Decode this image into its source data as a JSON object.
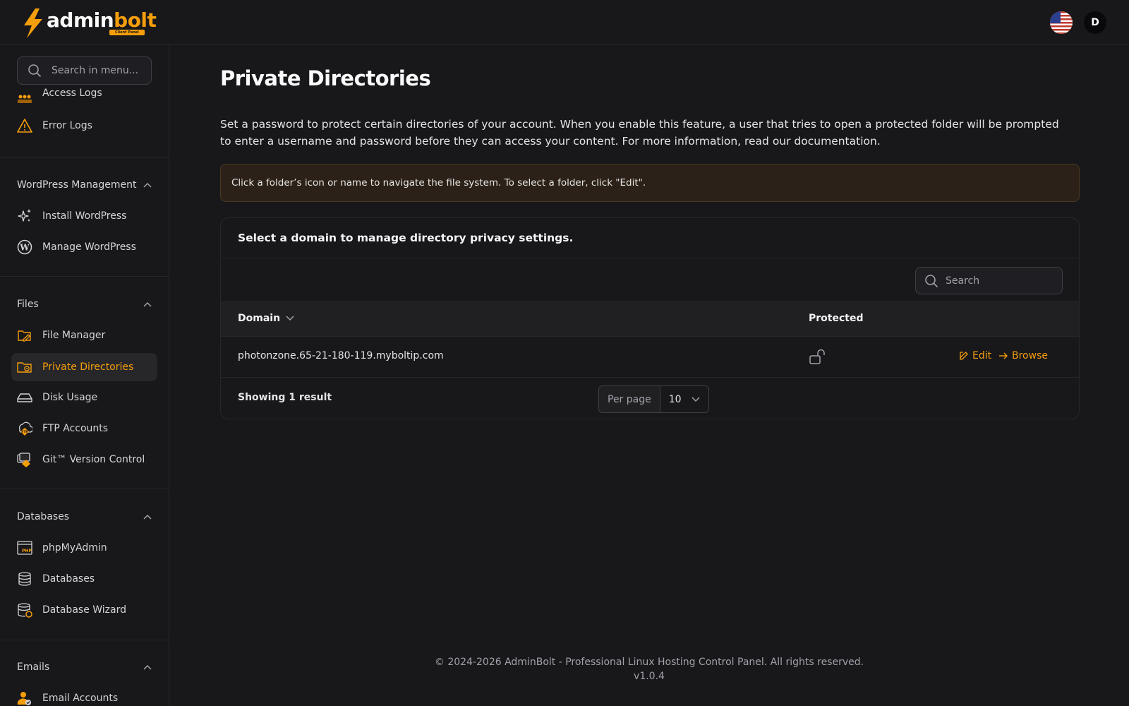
{
  "brand": {
    "name_white": "admin",
    "name_orange": "bolt",
    "badge": "Client Panel"
  },
  "header": {
    "avatar_initial": "D",
    "language_icon": "us-flag-icon"
  },
  "sidebar": {
    "search_placeholder": "Search in menu...",
    "top_items": [
      {
        "label": "Access Logs",
        "icon": "access-logs-icon"
      },
      {
        "label": "Error Logs",
        "icon": "warning-icon"
      }
    ],
    "groups": [
      {
        "title": "WordPress Management",
        "items": [
          {
            "label": "Install WordPress",
            "icon": "sparkles-icon"
          },
          {
            "label": "Manage WordPress",
            "icon": "wordpress-icon"
          }
        ]
      },
      {
        "title": "Files",
        "items": [
          {
            "label": "File Manager",
            "icon": "folder-edit-icon"
          },
          {
            "label": "Private Directories",
            "icon": "folder-lock-icon",
            "active": true
          },
          {
            "label": "Disk Usage",
            "icon": "hard-drive-icon"
          },
          {
            "label": "FTP Accounts",
            "icon": "ftp-icon"
          },
          {
            "label": "Git™ Version Control",
            "icon": "git-icon"
          }
        ]
      },
      {
        "title": "Databases",
        "items": [
          {
            "label": "phpMyAdmin",
            "icon": "phpmyadmin-icon"
          },
          {
            "label": "Databases",
            "icon": "database-icon"
          },
          {
            "label": "Database Wizard",
            "icon": "database-wizard-icon"
          }
        ]
      },
      {
        "title": "Emails",
        "items": [
          {
            "label": "Email Accounts",
            "icon": "email-accounts-icon"
          }
        ]
      }
    ]
  },
  "main": {
    "title": "Private Directories",
    "description": "Set a password to protect certain directories of your account. When you enable this feature, a user that tries to open a protected folder will be prompted to enter a username and password before they can access your content. For more information, read our documentation.",
    "notice": "Click a folder’s icon or name to navigate the file system. To select a folder, click \"Edit\".",
    "card_title": "Select a domain to manage directory privacy settings.",
    "search_placeholder": "Search",
    "table": {
      "columns": [
        "Domain",
        "Protected"
      ],
      "rows": [
        {
          "domain": "photonzone.65-21-180-119.myboltip.com",
          "protected": false,
          "edit_label": "Edit",
          "browse_label": "Browse"
        }
      ]
    },
    "showing": "Showing 1 result",
    "per_page_label": "Per page",
    "per_page_value": "10"
  },
  "footer": {
    "copyright": "© 2024-2026 AdminBolt - Professional Linux Hosting Control Panel. All rights reserved.",
    "version": "v1.0.4"
  },
  "colors": {
    "accent": "#f59e0b",
    "background": "#18181b",
    "border": "#27272a"
  }
}
